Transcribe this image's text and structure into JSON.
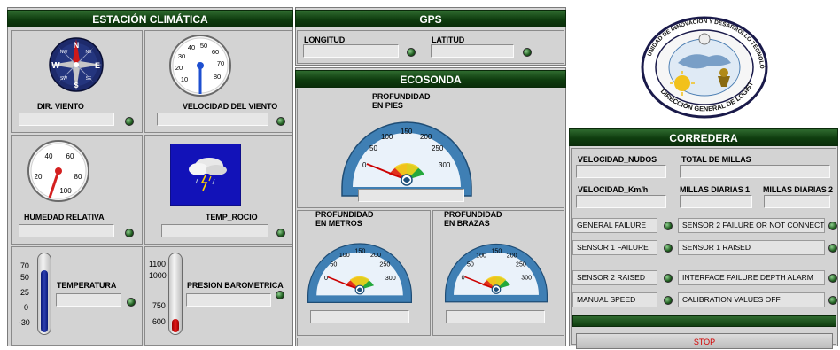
{
  "estacion": {
    "title": "ESTACIÓN CLIMÁTICA",
    "dir_viento": "DIR. VIENTO",
    "velocidad_viento": "VELOCIDAD DEL VIENTO",
    "humedad_relativa": "HUMEDAD RELATIVA",
    "temp_rocio": "TEMP_ROCIO",
    "temperatura": "TEMPERATURA",
    "presion": "PRESION BAROMETRICA",
    "compass": {
      "n": "N",
      "s": "S",
      "e": "E",
      "w": "W",
      "ne": "NE",
      "nw": "NW",
      "se": "SE",
      "sw": "SW"
    },
    "wind_ticks": [
      "10",
      "20",
      "30",
      "40",
      "50",
      "60",
      "70",
      "80"
    ],
    "humidity_ticks": [
      "20",
      "40",
      "60",
      "80",
      "100"
    ],
    "temp_scale": [
      "70",
      "50",
      "25",
      "0",
      "-30"
    ],
    "pressure_scale": [
      "1100",
      "1000",
      "750",
      "600"
    ]
  },
  "gps": {
    "title": "GPS",
    "longitud": "LONGITUD",
    "latitud": "LATITUD"
  },
  "logo": {
    "top_text": "UNIDAD DE INNOVACIÓN Y DESARROLLO TECNOLÓGICO",
    "bottom_text": "DIRECCIÓN GENERAL DE LOGÍSTICA"
  },
  "ecosonda": {
    "title": "ECOSONDA",
    "pies_label": "PROFUNDIDAD\nEN PIES",
    "metros_label": "PROFUNDIDAD\nEN METROS",
    "brazas_label": "PROFUNDIDAD\nEN BRAZAS",
    "gauge_ticks": [
      "0",
      "50",
      "100",
      "150",
      "200",
      "250",
      "300"
    ]
  },
  "corredera": {
    "title": "CORREDERA",
    "velocidad_nudos": "VELOCIDAD_NUDOS",
    "total_millas": "TOTAL DE MILLAS",
    "velocidad_kmh": "VELOCIDAD_Km/h",
    "millas_diarias_1": "MILLAS DIARIAS 1",
    "millas_diarias_2": "MILLAS DIARIAS 2",
    "status_left": [
      "GENERAL FAILURE",
      "SENSOR 1 FAILURE",
      "SENSOR 2 RAISED",
      "MANUAL SPEED"
    ],
    "status_right": [
      "SENSOR 2 FAILURE OR NOT CONNECTED",
      "SENSOR 1 RAISED",
      "INTERFACE FAILURE DEPTH ALARM",
      "CALIBRATION VALUES OFF"
    ],
    "stop_label": "STOP"
  }
}
